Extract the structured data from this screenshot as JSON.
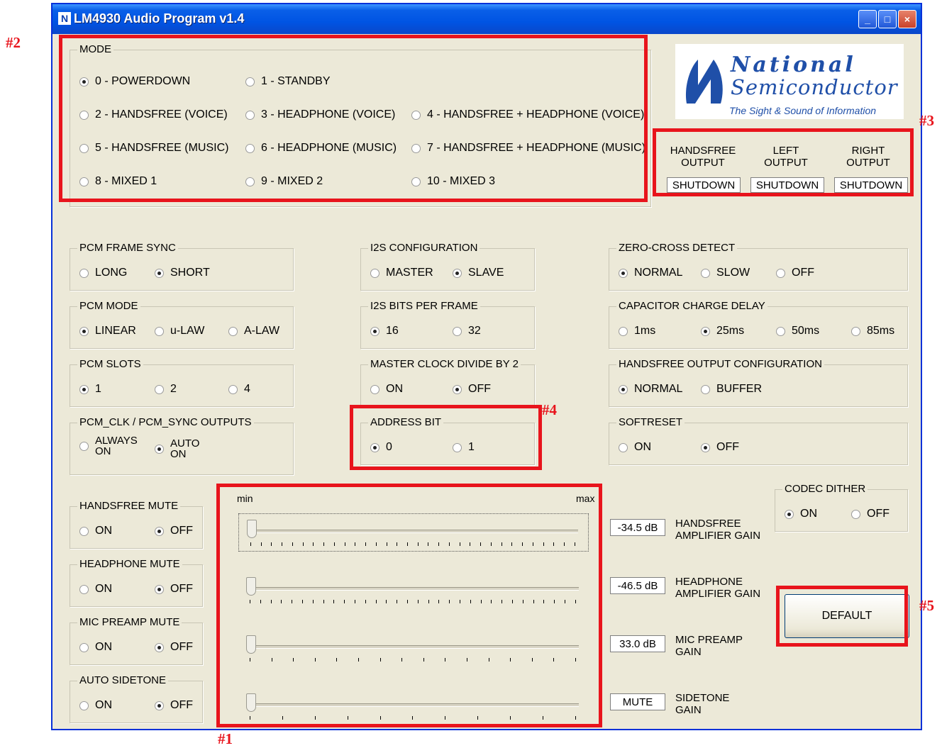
{
  "window": {
    "title": "LM4930 Audio Program v1.4",
    "controls": {
      "minimize": "_",
      "maximize": "□",
      "close": "×"
    }
  },
  "mode": {
    "legend": "MODE",
    "options": [
      {
        "label": "0 - POWERDOWN",
        "selected": true
      },
      {
        "label": "1 - STANDBY",
        "selected": false
      },
      {
        "label": "2 - HANDSFREE (VOICE)",
        "selected": false
      },
      {
        "label": "3 - HEADPHONE (VOICE)",
        "selected": false
      },
      {
        "label": "4 - HANDSFREE + HEADPHONE (VOICE)",
        "selected": false
      },
      {
        "label": "5 - HANDSFREE (MUSIC)",
        "selected": false
      },
      {
        "label": "6 - HEADPHONE (MUSIC)",
        "selected": false
      },
      {
        "label": "7 - HANDSFREE + HEADPHONE (MUSIC)",
        "selected": false
      },
      {
        "label": "8 - MIXED 1",
        "selected": false
      },
      {
        "label": "9 - MIXED 2",
        "selected": false
      },
      {
        "label": "10 - MIXED 3",
        "selected": false
      }
    ]
  },
  "logo": {
    "line1": "National",
    "line2": "Semiconductor",
    "tagline": "The Sight & Sound of Information"
  },
  "outputs": [
    {
      "line1": "HANDSFREE",
      "line2": "OUTPUT",
      "value": "SHUTDOWN"
    },
    {
      "line1": "LEFT",
      "line2": "OUTPUT",
      "value": "SHUTDOWN"
    },
    {
      "line1": "RIGHT",
      "line2": "OUTPUT",
      "value": "SHUTDOWN"
    }
  ],
  "pcm_frame_sync": {
    "legend": "PCM FRAME SYNC",
    "options": [
      {
        "label": "LONG",
        "selected": false
      },
      {
        "label": "SHORT",
        "selected": true
      }
    ]
  },
  "pcm_mode": {
    "legend": "PCM MODE",
    "options": [
      {
        "label": "LINEAR",
        "selected": true
      },
      {
        "label": "u-LAW",
        "selected": false
      },
      {
        "label": "A-LAW",
        "selected": false
      }
    ]
  },
  "pcm_slots": {
    "legend": "PCM SLOTS",
    "options": [
      {
        "label": "1",
        "selected": true
      },
      {
        "label": "2",
        "selected": false
      },
      {
        "label": "4",
        "selected": false
      }
    ]
  },
  "pcm_outputs": {
    "legend": "PCM_CLK / PCM_SYNC  OUTPUTS",
    "options": [
      {
        "line1": "ALWAYS",
        "line2": "ON",
        "selected": false
      },
      {
        "line1": "AUTO",
        "line2": "ON",
        "selected": true
      }
    ]
  },
  "i2s_config": {
    "legend": "I2S CONFIGURATION",
    "options": [
      {
        "label": "MASTER",
        "selected": false
      },
      {
        "label": "SLAVE",
        "selected": true
      }
    ]
  },
  "i2s_bits": {
    "legend": "I2S BITS PER FRAME",
    "options": [
      {
        "label": "16",
        "selected": true
      },
      {
        "label": "32",
        "selected": false
      }
    ]
  },
  "master_clock": {
    "legend": "MASTER CLOCK DIVIDE BY 2",
    "options": [
      {
        "label": "ON",
        "selected": false
      },
      {
        "label": "OFF",
        "selected": true
      }
    ]
  },
  "address_bit": {
    "legend": "ADDRESS BIT",
    "options": [
      {
        "label": "0",
        "selected": true
      },
      {
        "label": "1",
        "selected": false
      }
    ]
  },
  "zero_cross": {
    "legend": "ZERO-CROSS DETECT",
    "options": [
      {
        "label": "NORMAL",
        "selected": true
      },
      {
        "label": "SLOW",
        "selected": false
      },
      {
        "label": "OFF",
        "selected": false
      }
    ]
  },
  "cap_delay": {
    "legend": "CAPACITOR CHARGE DELAY",
    "options": [
      {
        "label": "1ms",
        "selected": false
      },
      {
        "label": "25ms",
        "selected": true
      },
      {
        "label": "50ms",
        "selected": false
      },
      {
        "label": "85ms",
        "selected": false
      }
    ]
  },
  "hf_output_config": {
    "legend": "HANDSFREE OUTPUT CONFIGURATION",
    "options": [
      {
        "label": "NORMAL",
        "selected": true
      },
      {
        "label": "BUFFER",
        "selected": false
      }
    ]
  },
  "softreset": {
    "legend": "SOFTRESET",
    "options": [
      {
        "label": "ON",
        "selected": false
      },
      {
        "label": "OFF",
        "selected": true
      }
    ]
  },
  "hf_mute": {
    "legend": "HANDSFREE MUTE",
    "options": [
      {
        "label": "ON",
        "selected": false
      },
      {
        "label": "OFF",
        "selected": true
      }
    ]
  },
  "hp_mute": {
    "legend": "HEADPHONE MUTE",
    "options": [
      {
        "label": "ON",
        "selected": false
      },
      {
        "label": "OFF",
        "selected": true
      }
    ]
  },
  "mic_mute": {
    "legend": "MIC PREAMP MUTE",
    "options": [
      {
        "label": "ON",
        "selected": false
      },
      {
        "label": "OFF",
        "selected": true
      }
    ]
  },
  "auto_sidetone": {
    "legend": "AUTO SIDETONE",
    "options": [
      {
        "label": "ON",
        "selected": false
      },
      {
        "label": "OFF",
        "selected": true
      }
    ]
  },
  "codec_dither": {
    "legend": "CODEC  DITHER",
    "options": [
      {
        "label": "ON",
        "selected": true
      },
      {
        "label": "OFF",
        "selected": false
      }
    ]
  },
  "sliders": {
    "min_label": "min",
    "max_label": "max",
    "items": [
      {
        "value": "-34.5 dB",
        "line1": "HANDSFREE",
        "line2": "AMPLIFIER GAIN",
        "level": 0.0,
        "ticks": 32
      },
      {
        "value": "-46.5 dB",
        "line1": "HEADPHONE",
        "line2": "AMPLIFIER GAIN",
        "level": 0.0,
        "ticks": 32
      },
      {
        "value": "33.0 dB",
        "line1": "MIC PREAMP",
        "line2": "GAIN",
        "level": 0.0,
        "ticks": 16
      },
      {
        "value": "MUTE",
        "line1": "SIDETONE",
        "line2": "GAIN",
        "level": 0.0,
        "ticks": 11
      }
    ]
  },
  "default_button": "DEFAULT",
  "annotations": [
    "#1",
    "#2",
    "#3",
    "#4",
    "#5"
  ]
}
